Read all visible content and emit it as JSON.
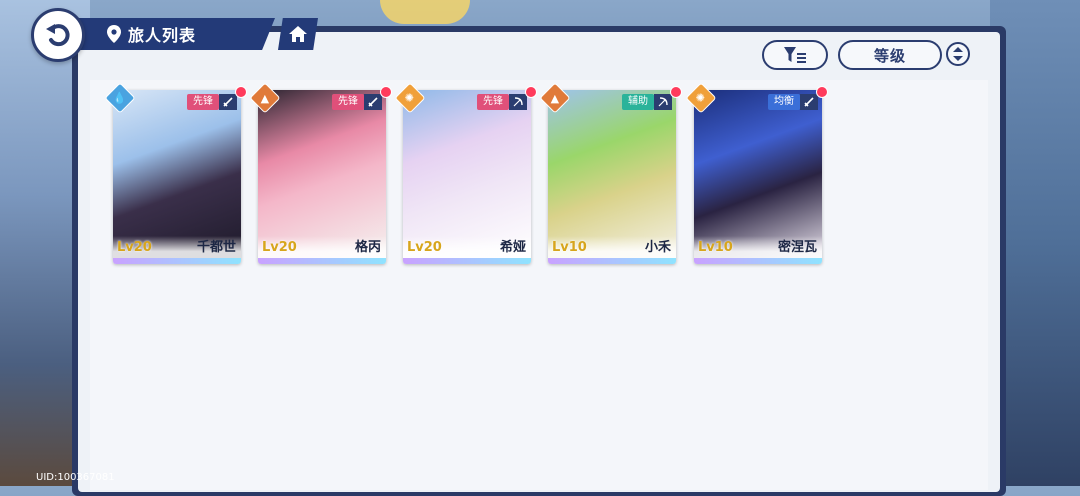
{
  "header": {
    "title": "旅人列表"
  },
  "controls": {
    "sort_label": "等级"
  },
  "colors": {
    "panel": "#eef2f7",
    "frame": "#2a3a66",
    "accent": "#2b3d70",
    "level": "#d7a51c",
    "badge_dot": "#ff3b5c"
  },
  "characters": [
    {
      "level": "Lv20",
      "name": "千都世",
      "role": "先锋",
      "role_color": "#e0507a",
      "element": "water-icon",
      "element_color": "#4aa3e0",
      "weapon": "sword-icon"
    },
    {
      "level": "Lv20",
      "name": "格丙",
      "role": "先锋",
      "role_color": "#e0507a",
      "element": "mountain-icon",
      "element_color": "#e07a3a",
      "weapon": "sword-icon"
    },
    {
      "level": "Lv20",
      "name": "希娅",
      "role": "先锋",
      "role_color": "#e0507a",
      "element": "sun-icon",
      "element_color": "#f0a03a",
      "weapon": "bow-icon"
    },
    {
      "level": "Lv10",
      "name": "小禾",
      "role": "辅助",
      "role_color": "#2bb39a",
      "element": "mountain-icon",
      "element_color": "#e07a3a",
      "weapon": "bow-icon"
    },
    {
      "level": "Lv10",
      "name": "密涅瓦",
      "role": "均衡",
      "role_color": "#3a6fd8",
      "element": "sun-icon",
      "element_color": "#f0a03a",
      "weapon": "sword-icon"
    }
  ],
  "footer": {
    "uid": "UID:100367081"
  }
}
